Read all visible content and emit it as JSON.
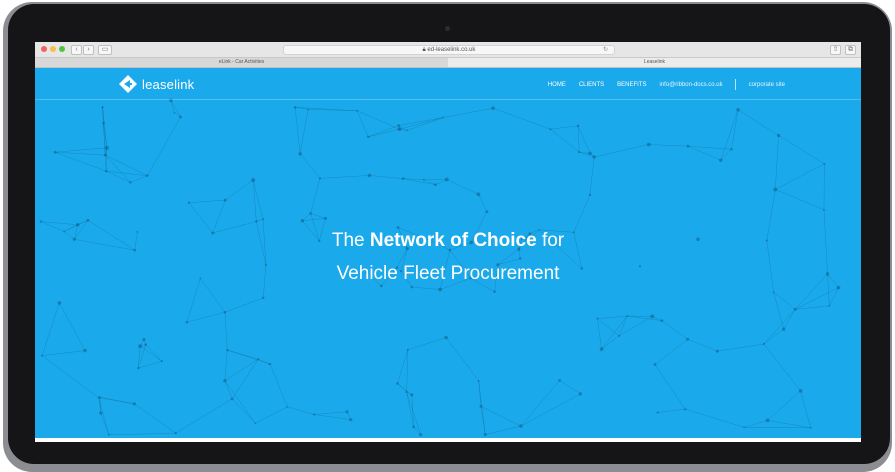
{
  "browser": {
    "address": "ed-leaselink.co.uk",
    "tabs": [
      {
        "label": "eLink - Car Activities",
        "active": false
      },
      {
        "label": "Leaselink",
        "active": true
      }
    ],
    "controls": {
      "back": "‹",
      "forward": "›",
      "sidebar": "▭",
      "reload": "↻",
      "share": "⇧",
      "new_tab": "⧉"
    }
  },
  "site": {
    "brand": "leaselink",
    "nav": {
      "home": "HOME",
      "clients": "CLIENTS",
      "benefits": "BENEFITS",
      "email": "info@ribbon-docs.co.uk",
      "corporate": "corporate site"
    },
    "hero": {
      "line1_prefix": "The ",
      "line1_bold": "Network of Choice",
      "line1_suffix": " for",
      "line2": "Vehicle Fleet Procurement"
    }
  },
  "colors": {
    "accent": "#1aa9eb",
    "chrome": "#e7e6e7",
    "bezel": "#151517"
  }
}
